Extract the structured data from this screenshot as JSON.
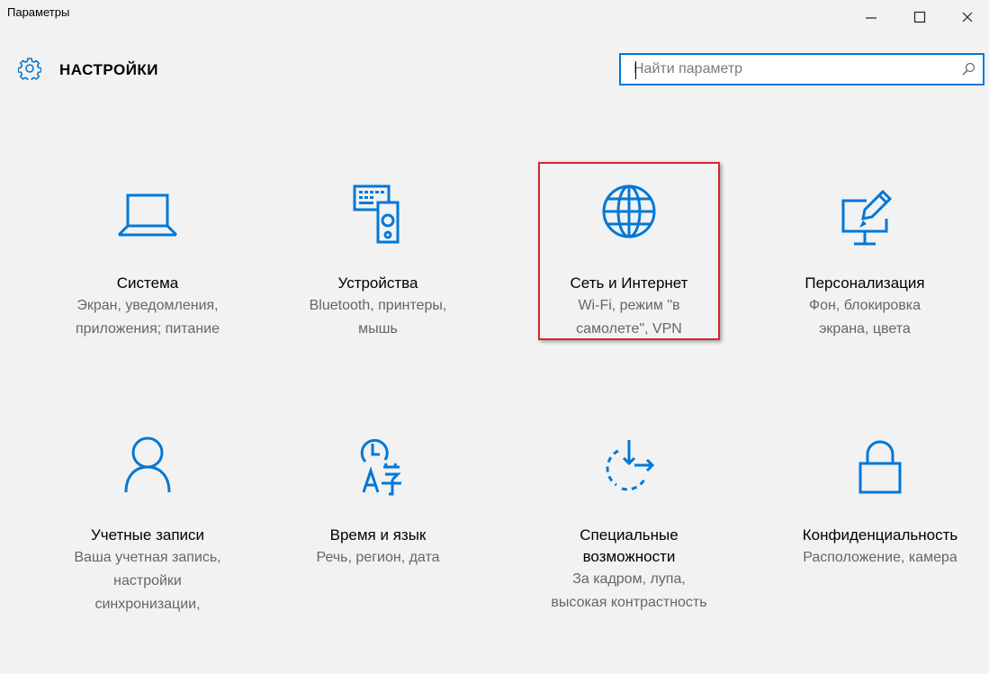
{
  "window": {
    "title": "Параметры",
    "minimize_glyph": "—",
    "maximize_glyph": "☐",
    "close_glyph": "✕"
  },
  "header": {
    "title": "НАСТРОЙКИ",
    "icon": "gear-icon"
  },
  "search": {
    "placeholder": "Найти параметр",
    "value": "",
    "icon": "search-icon"
  },
  "accent_color": "#0078d7",
  "highlight_color": "#d6272e",
  "tiles": [
    {
      "name": "Система",
      "desc": [
        "Экран, уведомления,",
        "приложения; питание"
      ],
      "icon": "laptop-icon"
    },
    {
      "name": "Устройства",
      "desc": [
        "Bluetooth, принтеры,",
        "мышь"
      ],
      "icon": "devices-icon"
    },
    {
      "name": "Сеть и Интернет",
      "desc": [
        "Wi-Fi, режим \"в",
        "самолете\", VPN"
      ],
      "icon": "globe-icon"
    },
    {
      "name": "Персонализация",
      "desc": [
        "Фон, блокировка",
        "экрана, цвета"
      ],
      "icon": "personalization-icon"
    },
    {
      "name": "Учетные записи",
      "desc": [
        "Ваша учетная запись,",
        "настройки",
        "синхронизации,"
      ],
      "icon": "person-icon"
    },
    {
      "name": "Время и язык",
      "desc": [
        "Речь, регион, дата"
      ],
      "icon": "time-language-icon"
    },
    {
      "name": "Специальные возможности",
      "name_lines": [
        "Специальные",
        "возможности"
      ],
      "desc": [
        "За кадром, лупа,",
        "высокая контрастность"
      ],
      "icon": "ease-of-access-icon"
    },
    {
      "name": "Конфиденциальность",
      "desc": [
        "Расположение, камера"
      ],
      "icon": "lock-icon"
    }
  ]
}
